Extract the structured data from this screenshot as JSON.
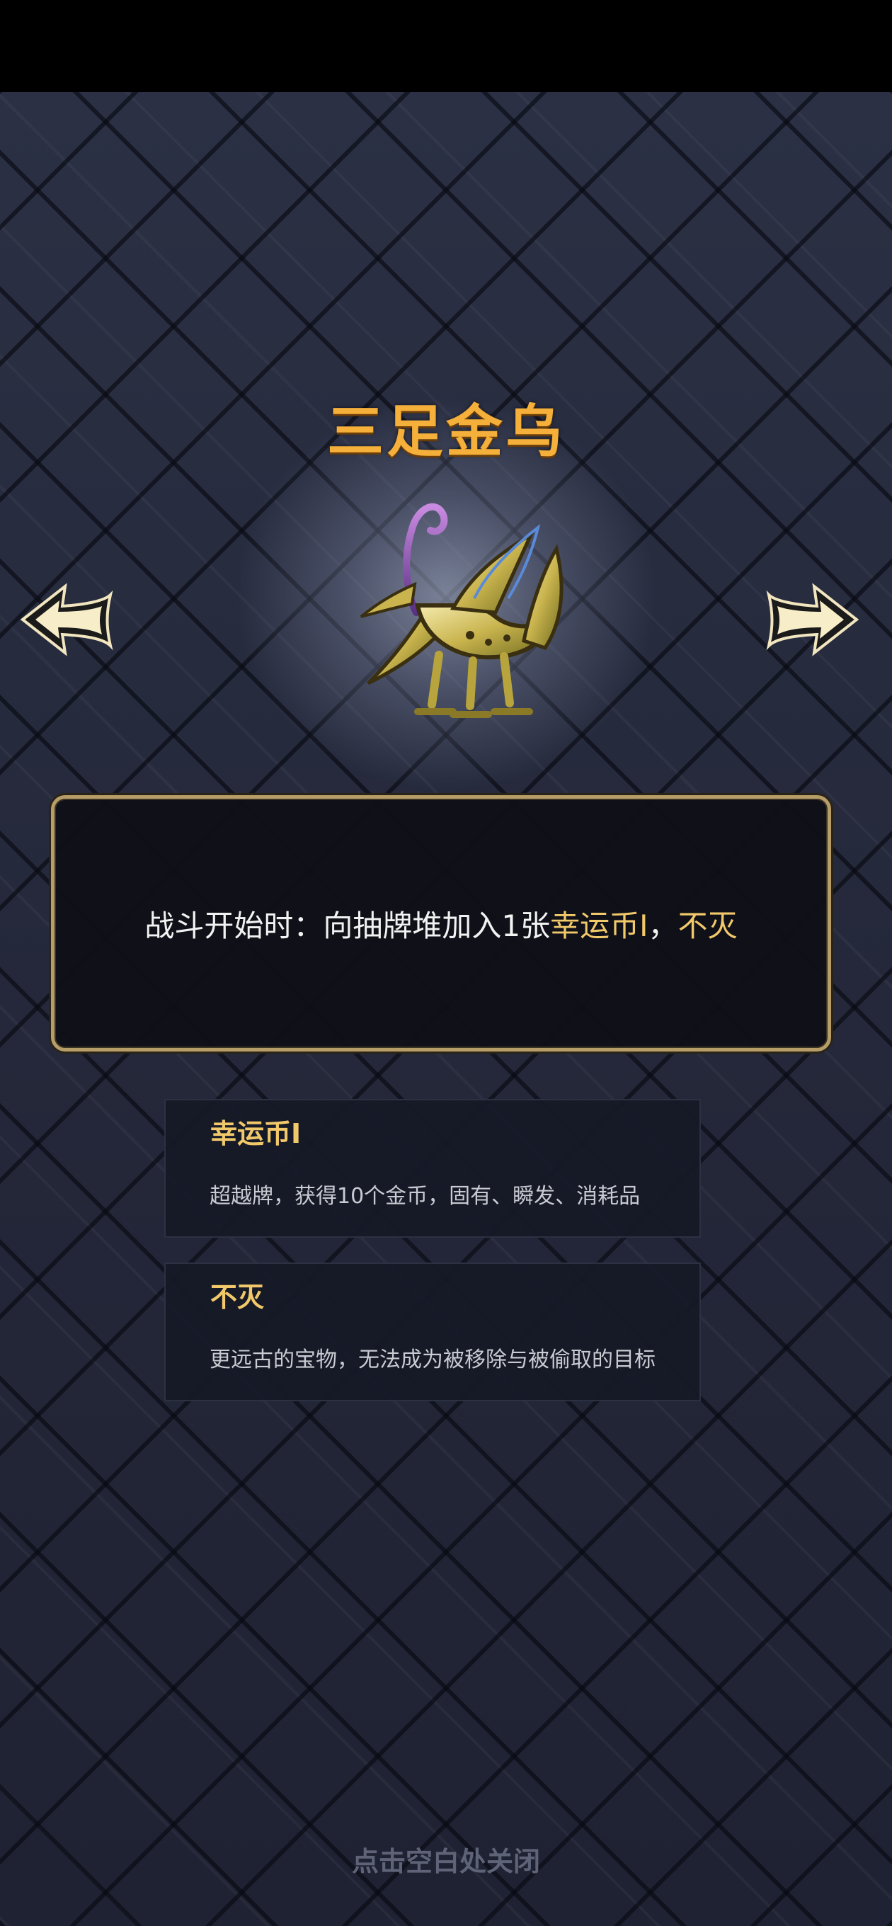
{
  "relic": {
    "name": "三足金乌",
    "description": {
      "prefix": "战斗开始时：向抽牌堆加入1张",
      "keyword1": "幸运币I",
      "separator": "，",
      "keyword2": "不灭"
    }
  },
  "keywords": [
    {
      "title": "幸运币I",
      "description": "超越牌，获得10个金币，固有、瞬发、消耗品"
    },
    {
      "title": "不灭",
      "description": "更远古的宝物，无法成为被移除与被偷取的目标"
    }
  ],
  "navigation": {
    "prev_icon": "left-arrow-icon",
    "next_icon": "right-arrow-icon"
  },
  "footer": {
    "close_hint": "点击空白处关闭"
  },
  "colors": {
    "title": "#f4b03a",
    "highlight": "#f1c86a",
    "frame": "#b79e68",
    "background": "#262a3c"
  }
}
